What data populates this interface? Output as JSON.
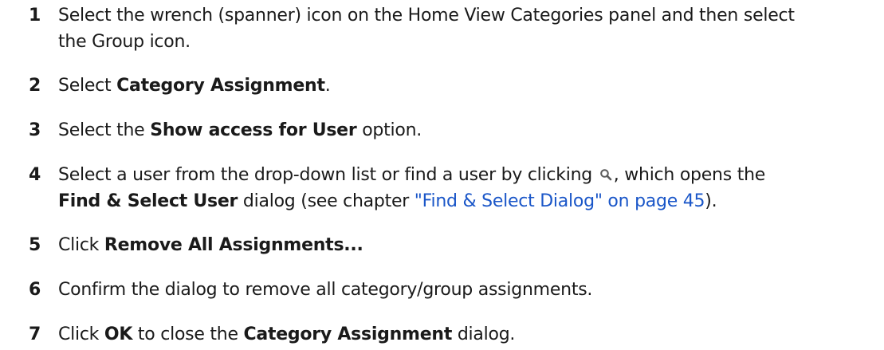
{
  "steps": [
    {
      "number": "1",
      "line1": "Select the wrench (spanner) icon on the Home View Categories panel and then select",
      "line2": "the Group icon."
    },
    {
      "number": "2",
      "pre": "Select ",
      "bold": "Category Assignment",
      "post": "."
    },
    {
      "number": "3",
      "pre": "Select the ",
      "bold": "Show access for User",
      "post": " option."
    },
    {
      "number": "4",
      "line1_pre": "Select a user from the drop-down list or find a user by clicking ",
      "icon": "magnifier-icon",
      "line1_post": ", which opens the",
      "bold": "Find & Select User",
      "line2_mid": " dialog (see chapter ",
      "link": "\"Find & Select Dialog\" on page 45",
      "line2_post": ")."
    },
    {
      "number": "5",
      "pre": "Click ",
      "bold": "Remove All Assignments..."
    },
    {
      "number": "6",
      "text": "Confirm the dialog to remove all category/group assignments."
    },
    {
      "number": "7",
      "pre": "Click ",
      "bold1": "OK",
      "mid": " to close the ",
      "bold2": "Category Assignment",
      "post": " dialog."
    }
  ],
  "colors": {
    "text": "#1a1a1a",
    "link": "#1a56c8"
  }
}
